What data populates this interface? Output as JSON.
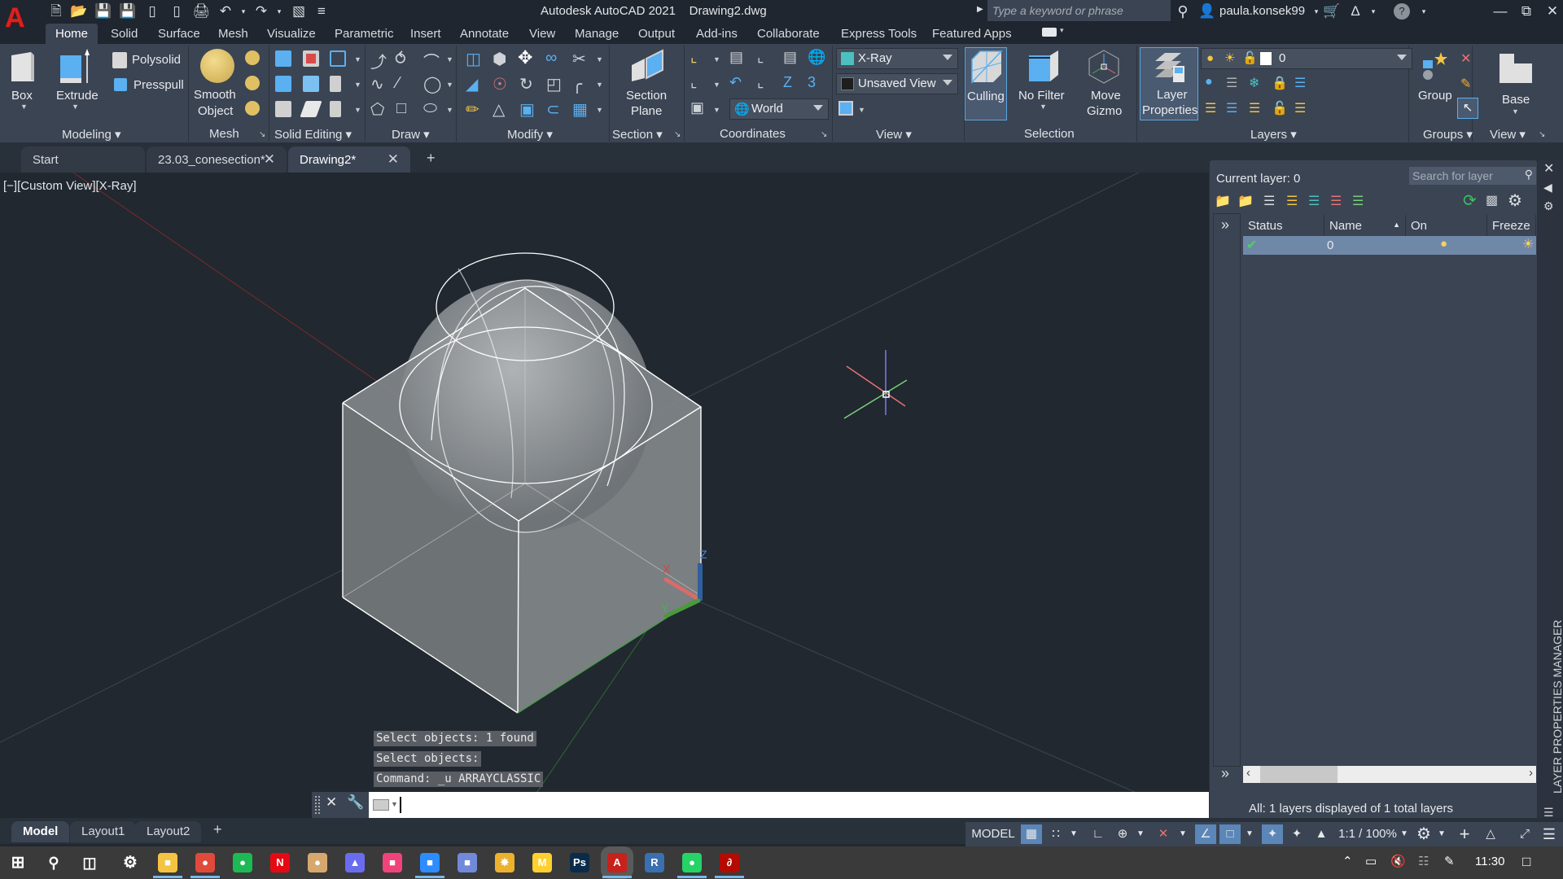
{
  "app": {
    "title": "Autodesk AutoCAD 2021",
    "file": "Drawing2.dwg",
    "search_placeholder": "Type a keyword or phrase",
    "user": "paula.konsek99"
  },
  "quick_access": [
    "new-icon",
    "open-icon",
    "save-icon",
    "save-as-icon",
    "open-from-web-icon",
    "save-to-web-icon",
    "plot-icon",
    "undo-icon",
    "redo-icon",
    "workspace-icon",
    "customize-icon"
  ],
  "ribbon_tabs": [
    {
      "label": "Home",
      "active": true
    },
    {
      "label": "Solid"
    },
    {
      "label": "Surface"
    },
    {
      "label": "Mesh"
    },
    {
      "label": "Visualize"
    },
    {
      "label": "Parametric"
    },
    {
      "label": "Insert"
    },
    {
      "label": "Annotate"
    },
    {
      "label": "View"
    },
    {
      "label": "Manage"
    },
    {
      "label": "Output"
    },
    {
      "label": "Add-ins"
    },
    {
      "label": "Collaborate"
    },
    {
      "label": "Express Tools"
    },
    {
      "label": "Featured Apps"
    }
  ],
  "ribbon": {
    "modeling": {
      "label": "Modeling",
      "box": "Box",
      "extrude": "Extrude",
      "polysolid": "Polysolid",
      "presspull": "Presspull"
    },
    "mesh": {
      "label": "Mesh",
      "smooth_line1": "Smooth",
      "smooth_line2": "Object"
    },
    "solid_editing": {
      "label": "Solid Editing"
    },
    "draw": {
      "label": "Draw"
    },
    "modify": {
      "label": "Modify"
    },
    "section": {
      "label": "Section",
      "btn_line1": "Section",
      "btn_line2": "Plane"
    },
    "coordinates": {
      "label": "Coordinates",
      "ucs_combo": "World"
    },
    "view": {
      "label": "View",
      "visual_style": "X-Ray",
      "named_view": "Unsaved View"
    },
    "selection": {
      "label": "Selection",
      "culling": "Culling",
      "no_filter": "No Filter",
      "move_line1": "Move",
      "move_line2": "Gizmo"
    },
    "layers": {
      "label": "Layers",
      "layer_props_line1": "Layer",
      "layer_props_line2": "Properties",
      "current_layer": "0"
    },
    "groups": {
      "label": "Groups",
      "group": "Group"
    },
    "view2": {
      "label": "View",
      "base": "Base"
    }
  },
  "doc_tabs": [
    {
      "label": "Start"
    },
    {
      "label": "23.03_conesection*",
      "closable": true
    },
    {
      "label": "Drawing2*",
      "closable": true,
      "active": true
    }
  ],
  "viewport": {
    "view_controls": "[−][Custom View][X-Ray]",
    "command_history": [
      "Select objects: 1 found",
      "Select objects:",
      "Command: _u ARRAYCLASSIC"
    ],
    "command_input": "",
    "ucs_labels": {
      "x": "X",
      "y": "Y",
      "z": "Z"
    }
  },
  "layer_panel": {
    "current_layer": "Current layer: 0",
    "search_placeholder": "Search for layer",
    "columns": [
      "Status",
      "Name",
      "On",
      "Freeze"
    ],
    "rows": [
      {
        "status": "current",
        "name": "0",
        "on": true,
        "freeze": false
      }
    ],
    "footer": "All: 1 layers displayed of 1 total layers",
    "side_title": "LAYER PROPERTIES MANAGER",
    "expand": "»"
  },
  "layout_tabs": [
    {
      "label": "Model",
      "active": true
    },
    {
      "label": "Layout1"
    },
    {
      "label": "Layout2"
    }
  ],
  "status_bar": {
    "model": "MODEL",
    "scale": "1:1 / 100%"
  },
  "taskbar": {
    "apps": [
      {
        "name": "file-explorer",
        "glyph": "■",
        "color": "#f5c342"
      },
      {
        "name": "chrome",
        "glyph": "●",
        "color": "#e04a3b"
      },
      {
        "name": "spotify",
        "glyph": "●",
        "color": "#1db954"
      },
      {
        "name": "netflix",
        "glyph": "N",
        "color": "#e50914"
      },
      {
        "name": "app-orb",
        "glyph": "●",
        "color": "#d7a86e"
      },
      {
        "name": "app-flame",
        "glyph": "▲",
        "color": "#6a6cf0"
      },
      {
        "name": "creative-cloud",
        "glyph": "■",
        "color": "#f0437c"
      },
      {
        "name": "zoom",
        "glyph": "■",
        "color": "#2d8cff"
      },
      {
        "name": "discord",
        "glyph": "■",
        "color": "#7289da"
      },
      {
        "name": "slack",
        "glyph": "✸",
        "color": "#ecb22e"
      },
      {
        "name": "miro",
        "glyph": "M",
        "color": "#ffd02f"
      },
      {
        "name": "photoshop",
        "glyph": "Ps",
        "color": "#0a2b4a"
      },
      {
        "name": "autocad",
        "glyph": "A",
        "color": "#c8211b"
      },
      {
        "name": "revit",
        "glyph": "R",
        "color": "#3a6fb0"
      },
      {
        "name": "whatsapp",
        "glyph": "●",
        "color": "#25d366"
      },
      {
        "name": "acrobat",
        "glyph": "∂",
        "color": "#b30b00"
      }
    ],
    "time": "11:30"
  }
}
